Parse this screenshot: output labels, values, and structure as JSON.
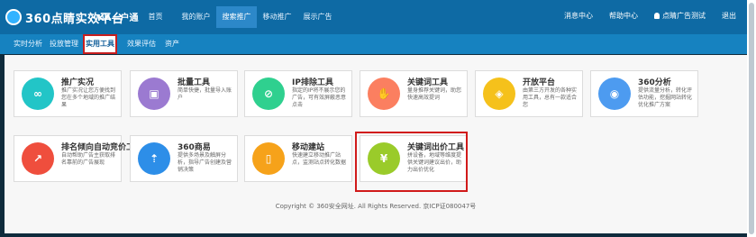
{
  "header": {
    "logo_text": "360点睛实效平台",
    "account": "KA—户通",
    "nav": [
      "首页",
      "我的账户",
      "搜索推广",
      "移动推广",
      "展示广告"
    ],
    "active_nav_index": 2,
    "right_links": [
      "消息中心",
      "帮助中心"
    ],
    "user_name": "点睛广告测试",
    "logout_label": "退出"
  },
  "subnav": {
    "items": [
      "实时分析",
      "投放管理",
      "实用工具",
      "效果评估",
      "资产"
    ],
    "active_index": 2
  },
  "cards": [
    {
      "title": "推广实况",
      "desc": "推广实况让您方便找到您在多个地域的推广结果",
      "icon": "binoculars-icon",
      "icon_color": "#22c5c7"
    },
    {
      "title": "批量工具",
      "desc": "简单快捷，批量导入账户",
      "icon": "box-upload-icon",
      "icon_color": "#9b7ad1"
    },
    {
      "title": "IP排除工具",
      "desc": "指定的IP将不展示您的广告，可有效屏蔽恶意点击",
      "icon": "ip-block-icon",
      "icon_color": "#2fd08f"
    },
    {
      "title": "关键词工具",
      "desc": "量身推荐关键词，助您快速高效提词",
      "icon": "hand-keyword-icon",
      "icon_color": "#fb7f60"
    },
    {
      "title": "开放平台",
      "desc": "由第三方开发的各种实用工具，总有一款适合您",
      "icon": "cube-icon",
      "icon_color": "#f5c11b"
    },
    {
      "title": "360分析",
      "desc": "提供流量分析，转化评估功能，挖掘网站转化优化推广方案",
      "icon": "analysis-icon",
      "icon_color": "#4d9bf0"
    },
    {
      "title": "排名倾向自动竞价工具",
      "desc": "自动帮助广告主获取排名靠前的广告展现",
      "icon": "chart-rising-icon",
      "icon_color": "#ef4e3d"
    },
    {
      "title": "360商易",
      "desc": "提供多场景及触屏分析，指导广告创建及营销决策",
      "icon": "trend-icon",
      "icon_color": "#2d8ee8"
    },
    {
      "title": "移动建站",
      "desc": "快速建立移动推广站点，监测站点转化数据",
      "icon": "mobile-icon",
      "icon_color": "#f6a21a"
    },
    {
      "title": "关键词出价工具",
      "desc": "拼设备，地域等维度提供关键词建议出价，助力出价优化",
      "icon": "price-icon",
      "icon_color": "#9acb2a"
    }
  ],
  "footer": {
    "copyright": "Copyright © 360安全网址. All Rights Reserved. 京ICP证080047号"
  }
}
